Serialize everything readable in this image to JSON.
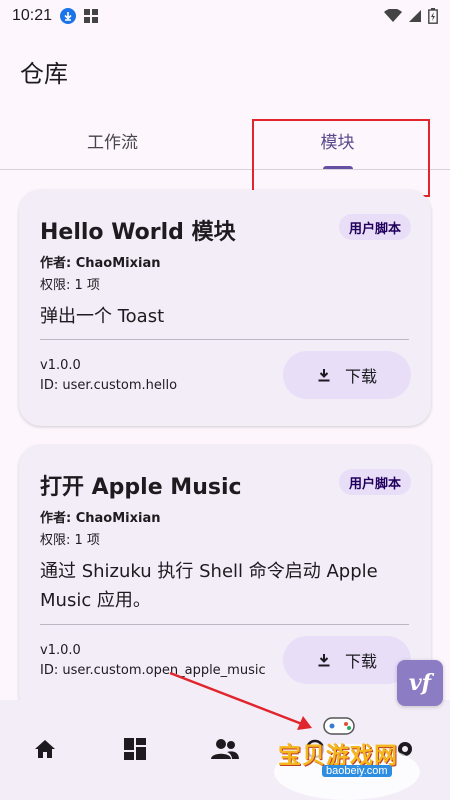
{
  "status_bar": {
    "time": "10:21",
    "icons": [
      "download-icon",
      "grid-app-icon",
      "wifi-icon",
      "cellular-icon",
      "battery-icon"
    ]
  },
  "app": {
    "title": "仓库"
  },
  "tabs": [
    {
      "label": "工作流",
      "active": false
    },
    {
      "label": "模块",
      "active": true
    }
  ],
  "modules": [
    {
      "title": "Hello World 模块",
      "badge": "用户脚本",
      "author_label": "作者: ",
      "author": "ChaoMixian",
      "permissions": "权限: 1 项",
      "description": "弹出一个 Toast",
      "version": "v1.0.0",
      "id": "ID: user.custom.hello",
      "download_label": "下载"
    },
    {
      "title": "打开 Apple Music",
      "badge": "用户脚本",
      "author_label": "作者: ",
      "author": "ChaoMixian",
      "permissions": "权限: 1 项",
      "description": "通过 Shizuku 执行 Shell 命令启动 Apple Music 应用。",
      "version": "v1.0.0",
      "id": "ID: user.custom.open_apple_music",
      "download_label": "下载"
    }
  ],
  "bottom_nav": [
    "home-icon",
    "dashboard-icon",
    "people-icon",
    "store-icon",
    "settings-icon"
  ],
  "overlay": {
    "vf_badge": "vf",
    "watermark_text": "宝贝游戏网",
    "watermark_url": "baobeiy.com"
  },
  "colors": {
    "accent": "#6750a4",
    "badge_bg": "#e8def8",
    "card_bg": "#f3edf7",
    "highlight": "#e0262c"
  }
}
